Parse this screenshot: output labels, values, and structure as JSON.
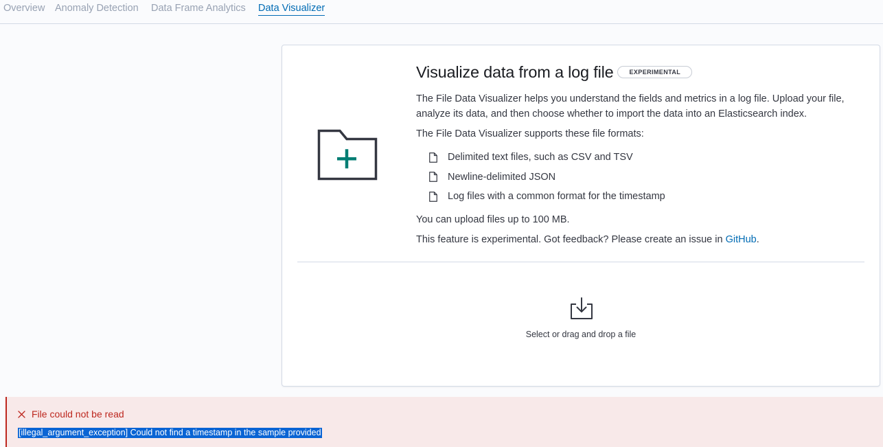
{
  "nav": {
    "tabs": [
      {
        "label": "Overview",
        "active": false
      },
      {
        "label": "Anomaly Detection",
        "active": false
      },
      {
        "label": "Data Frame Analytics",
        "active": false
      },
      {
        "label": "Data Visualizer",
        "active": true
      }
    ]
  },
  "panel": {
    "title": "Visualize data from a log file",
    "badge": "EXPERIMENTAL",
    "description": "The File Data Visualizer helps you understand the fields and metrics in a log file. Upload your file, analyze its data, and then choose whether to import the data into an Elasticsearch index.",
    "formats_intro": "The File Data Visualizer supports these file formats:",
    "formats": [
      "Delimited text files, such as CSV and TSV",
      "Newline-delimited JSON",
      "Log files with a common format for the timestamp"
    ],
    "size_note": "You can upload files up to 100 MB.",
    "feedback_prefix": "This feature is experimental. Got feedback? Please create an issue in ",
    "feedback_link": "GitHub",
    "feedback_suffix": ".",
    "dropzone_label": "Select or drag and drop a file",
    "icons": {
      "folder": "folder-add-icon",
      "document": "document-icon",
      "upload": "upload-tray-icon"
    }
  },
  "error": {
    "title": "File could not be read",
    "message": "[illegal_argument_exception] Could not find a timestamp in the sample provided",
    "icon": "close-icon"
  },
  "colors": {
    "accent": "#006bb4",
    "plus": "#017d73",
    "danger": "#bd271e",
    "danger_bg": "#f8e9e9",
    "selection": "#0a64d4"
  }
}
